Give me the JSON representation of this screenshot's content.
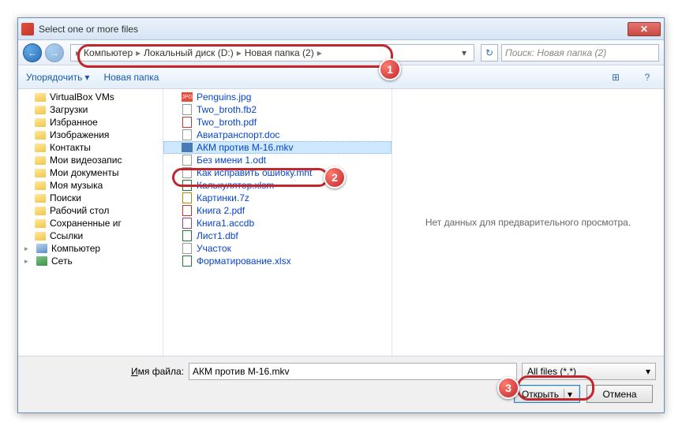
{
  "titlebar": {
    "title": "Select one or more files",
    "close": "✕"
  },
  "nav": {
    "back": "←",
    "forward": "→",
    "crumbs": [
      "Компьютер",
      "Локальный диск (D:)",
      "Новая папка (2)"
    ],
    "crumb_sep": "▸",
    "refresh": "↻",
    "search_placeholder": "Поиск: Новая папка (2)"
  },
  "toolbar": {
    "organize": "Упорядочить",
    "drop": "▾",
    "newfolder": "Новая папка",
    "view_icon": "⊞",
    "help_icon": "?"
  },
  "sidebar": [
    {
      "label": "VirtualBox VMs",
      "icon": "folder"
    },
    {
      "label": "Загрузки",
      "icon": "folder"
    },
    {
      "label": "Избранное",
      "icon": "folder"
    },
    {
      "label": "Изображения",
      "icon": "folder"
    },
    {
      "label": "Контакты",
      "icon": "folder"
    },
    {
      "label": "Мои видеозапис",
      "icon": "folder"
    },
    {
      "label": "Мои документы",
      "icon": "folder"
    },
    {
      "label": "Моя музыка",
      "icon": "folder"
    },
    {
      "label": "Поиски",
      "icon": "folder"
    },
    {
      "label": "Рабочий стол",
      "icon": "folder"
    },
    {
      "label": "Сохраненные иг",
      "icon": "folder"
    },
    {
      "label": "Ссылки",
      "icon": "folder"
    }
  ],
  "sidebar_root": [
    {
      "label": "Компьютер",
      "icon": "comp",
      "exp": "▸"
    },
    {
      "label": "Сеть",
      "icon": "net",
      "exp": "▸"
    }
  ],
  "files": [
    {
      "name": "Penguins.jpg",
      "icon": "img"
    },
    {
      "name": "Two_broth.fb2",
      "icon": "doc"
    },
    {
      "name": "Two_broth.pdf",
      "icon": "pdf"
    },
    {
      "name": "Авиатранспорт.doc",
      "icon": "doc"
    },
    {
      "name": "АКМ против М-16.mkv",
      "icon": "vid",
      "selected": true
    },
    {
      "name": "Без имени 1.odt",
      "icon": "doc"
    },
    {
      "name": "Как исправить ошибку.mht",
      "icon": "doc"
    },
    {
      "name": "Калькулятор.xlsm",
      "icon": "xls"
    },
    {
      "name": "Картинки.7z",
      "icon": "zip"
    },
    {
      "name": "Книга 2.pdf",
      "icon": "pdf"
    },
    {
      "name": "Книга1.accdb",
      "icon": "db"
    },
    {
      "name": "Лист1.dbf",
      "icon": "xls"
    },
    {
      "name": "Участок",
      "icon": "doc"
    },
    {
      "name": "Форматирование.xlsx",
      "icon": "xls"
    }
  ],
  "preview": {
    "empty": "Нет данных для предварительного просмотра."
  },
  "footer": {
    "filename_label": "Имя файла:",
    "filename_value": "АКМ против М-16.mkv",
    "filter": "All files (*.*)",
    "filter_drop": "▾",
    "open": "Открыть",
    "open_drop": "▾",
    "cancel": "Отмена"
  },
  "badges": {
    "b1": "1",
    "b2": "2",
    "b3": "3"
  }
}
